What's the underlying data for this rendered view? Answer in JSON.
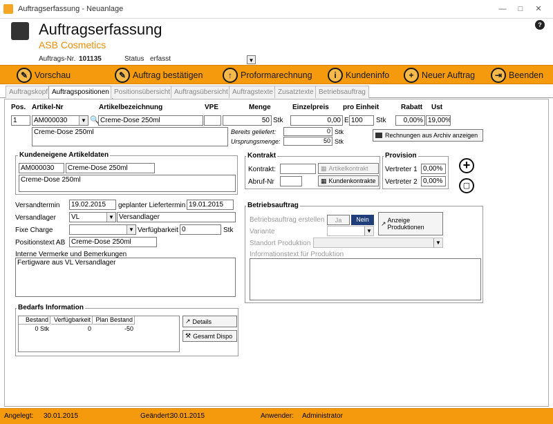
{
  "window": {
    "title": "Auftragserfassung - Neuanlage"
  },
  "header": {
    "title": "Auftragserfassung",
    "company": "ASB Cosmetics",
    "order_no_label": "Auftrags-Nr.",
    "order_no": "101135",
    "status_label": "Status",
    "status": "erfasst"
  },
  "toolbar": {
    "items": [
      {
        "label": "Vorschau"
      },
      {
        "label": "Auftrag bestätigen"
      },
      {
        "label": "Proformarechnung"
      },
      {
        "label": "Kundeninfo"
      },
      {
        "label": "Neuer Auftrag"
      },
      {
        "label": "Beenden"
      }
    ]
  },
  "tabs": [
    {
      "label": "Auftragskopf"
    },
    {
      "label": "Auftragspositionen"
    },
    {
      "label": "Positionsübersicht"
    },
    {
      "label": "Auftragsübersicht"
    },
    {
      "label": "Auftragstexte"
    },
    {
      "label": "Zusatztexte"
    },
    {
      "label": "Betriebsauftrag"
    }
  ],
  "columns": {
    "pos": "Pos.",
    "artikel_nr": "Artikel-Nr",
    "bezeichnung": "Artikelbezeichnung",
    "vpe": "VPE",
    "menge": "Menge",
    "einzelpreis": "Einzelpreis",
    "pro_einheit": "pro Einheit",
    "rabatt": "Rabatt",
    "ust": "Ust"
  },
  "position": {
    "pos": "1",
    "artikel_nr": "AM000030",
    "bezeichnung": "Creme-Dose 250ml",
    "vpe": "",
    "menge": "50",
    "menge_unit": "Stk",
    "einzelpreis": "0,00",
    "currency": "Eur",
    "pro_einheit": "100",
    "einheit_unit": "Stk",
    "rabatt": "0,00%",
    "ust": "19,00%",
    "desc": "Creme-Dose   250ml",
    "bereits_label": "Bereits geliefert:",
    "bereits": "0",
    "bereits_unit": "Stk",
    "ursprung_label": "Ursprungsmenge:",
    "ursprung": "50",
    "ursprung_unit": "Stk",
    "rechnungen_btn": "Rechnungen aus  Archiv anzeigen"
  },
  "kunden": {
    "title": "Kundeneigene Artikeldaten",
    "nr": "AM000030",
    "bez": "Creme-Dose 250ml",
    "text": "Creme-Dose 250ml"
  },
  "kontrakt": {
    "title": "Kontrakt",
    "kontrakt_label": "Kontrakt:",
    "abruf_label": "Abruf-Nr",
    "artikelkontrakt_btn": "Artikelkontrakt",
    "kundenkontrakte_btn": "Kundenkontrakte"
  },
  "provision": {
    "title": "Provision",
    "v1_label": "Vertreter 1",
    "v1": "0,00%",
    "v2_label": "Vertreter 2",
    "v2": "0,00%"
  },
  "versand": {
    "termin_label": "Versandtermin",
    "termin": "19.02.2015",
    "geplant_label": "geplanter Liefertermin",
    "geplant": "19.01.2015",
    "lager_label": "Versandlager",
    "lager_code": "VL",
    "lager_name": "Versandlager",
    "charge_label": "Fixe Charge",
    "charge": "",
    "verf_label": "Verfügbarkeit",
    "verf": "0",
    "verf_unit": "Stk",
    "postext_label": "Positionstext AB",
    "postext": "Creme-Dose 250ml",
    "interne_label": "Interne Vermerke und Bemerkungen",
    "interne": "Fertigware aus VL Versandlager"
  },
  "betrieb": {
    "title": "Betriebsauftrag",
    "erstellen_label": "Betriebsauftrag erstellen",
    "ja": "Ja",
    "nein": "Nein",
    "anzeige_btn": "Anzeige Produktionen",
    "variante_label": "Variante",
    "standort_label": "Standort Produktion",
    "info_label": "Informationstext für Produktion"
  },
  "bedarf": {
    "title": "Bedarfs Information",
    "headers": [
      "Bestand",
      "Verfügbarkeit",
      "Plan Bestand"
    ],
    "row": [
      "0 Stk",
      "0",
      "-50"
    ],
    "details_btn": "Details",
    "dispo_btn": "Gesamt Dispo"
  },
  "status": {
    "angelegt_label": "Angelegt:",
    "angelegt": "30.01.2015",
    "geaendert_label": "Geändert:",
    "geaendert": "30.01.2015",
    "anwender_label": "Anwender:",
    "anwender": "Administrator"
  },
  "colors": {
    "accent": "#f59a0c",
    "brand_text": "#f08c00",
    "active_btn": "#1f3e7a"
  }
}
